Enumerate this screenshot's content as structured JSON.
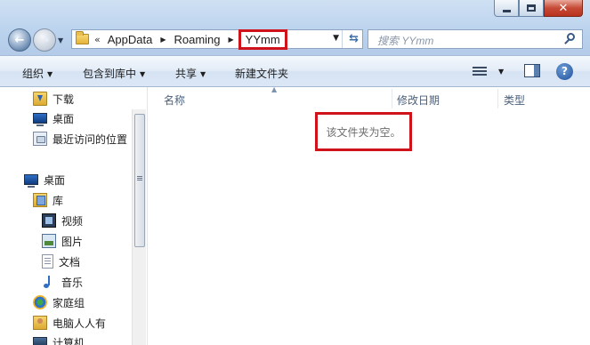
{
  "address_bar": {
    "overflow": "«",
    "crumbs": [
      "AppData",
      "Roaming"
    ],
    "current": "YYmm"
  },
  "search": {
    "placeholder": "搜索 YYmm"
  },
  "command_bar": {
    "organize": "组织",
    "include_in_library": "包含到库中",
    "share": "共享",
    "new_folder": "新建文件夹"
  },
  "nav_pane": {
    "favorites": [
      {
        "label": "下载",
        "icon": "download-folder-icon"
      },
      {
        "label": "桌面",
        "icon": "desktop-icon"
      },
      {
        "label": "最近访问的位置",
        "icon": "recent-places-icon"
      }
    ],
    "desktop_root": "桌面",
    "library": "库",
    "library_items": [
      {
        "label": "视频",
        "icon": "video-library-icon"
      },
      {
        "label": "图片",
        "icon": "picture-library-icon"
      },
      {
        "label": "文档",
        "icon": "document-library-icon"
      },
      {
        "label": "音乐",
        "icon": "music-library-icon"
      }
    ],
    "homegroup": "家庭组",
    "user_folder": "电脑人人有",
    "computer": "计算机"
  },
  "columns": {
    "name": "名称",
    "modified": "修改日期",
    "type": "类型"
  },
  "content": {
    "empty_message": "该文件夹为空。"
  },
  "colors": {
    "highlight_box": "#d0121b",
    "command_bar": "#dbe7f5",
    "frame": "#bcd3ee"
  }
}
